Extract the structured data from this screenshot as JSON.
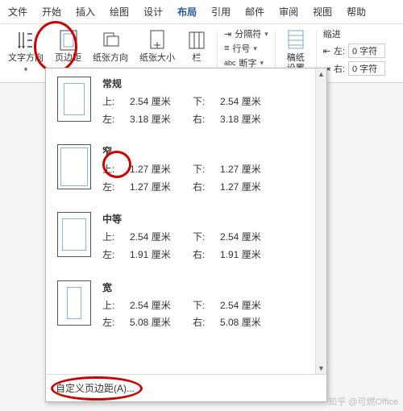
{
  "menubar": {
    "items": [
      "文件",
      "开始",
      "插入",
      "绘图",
      "设计",
      "布局",
      "引用",
      "邮件",
      "审阅",
      "视图",
      "帮助"
    ],
    "activeIndex": 5
  },
  "ribbon": {
    "text_direction": "文字方向",
    "margins": "页边距",
    "orientation": "纸张方向",
    "size": "纸张大小",
    "columns": "栏",
    "breaks": "分隔符",
    "line_numbers": "行号",
    "hyphenation": "断字",
    "manuscript": "稿纸\n设置",
    "indent_label": "缩进",
    "indent_left_prefix": "左:",
    "indent_right_prefix": "右:",
    "indent_left_value": "0 字符",
    "indent_right_value": "0 字符"
  },
  "dropdown": {
    "presets": [
      {
        "name": "常规",
        "thumb": "normal",
        "top": "2.54 厘米",
        "bottom": "2.54 厘米",
        "left": "3.18 厘米",
        "right": "3.18 厘米"
      },
      {
        "name": "窄",
        "thumb": "narrow",
        "top": "1.27 厘米",
        "bottom": "1.27 厘米",
        "left": "1.27 厘米",
        "right": "1.27 厘米"
      },
      {
        "name": "中等",
        "thumb": "moderate",
        "top": "2.54 厘米",
        "bottom": "2.54 厘米",
        "left": "1.91 厘米",
        "right": "1.91 厘米"
      },
      {
        "name": "宽",
        "thumb": "wide",
        "top": "2.54 厘米",
        "bottom": "2.54 厘米",
        "left": "5.08 厘米",
        "right": "5.08 厘米"
      }
    ],
    "labels": {
      "top": "上:",
      "bottom": "下:",
      "left": "左:",
      "right": "右:"
    },
    "custom": "自定义页边距(A)..."
  },
  "watermark": "知乎 @可燃Office"
}
